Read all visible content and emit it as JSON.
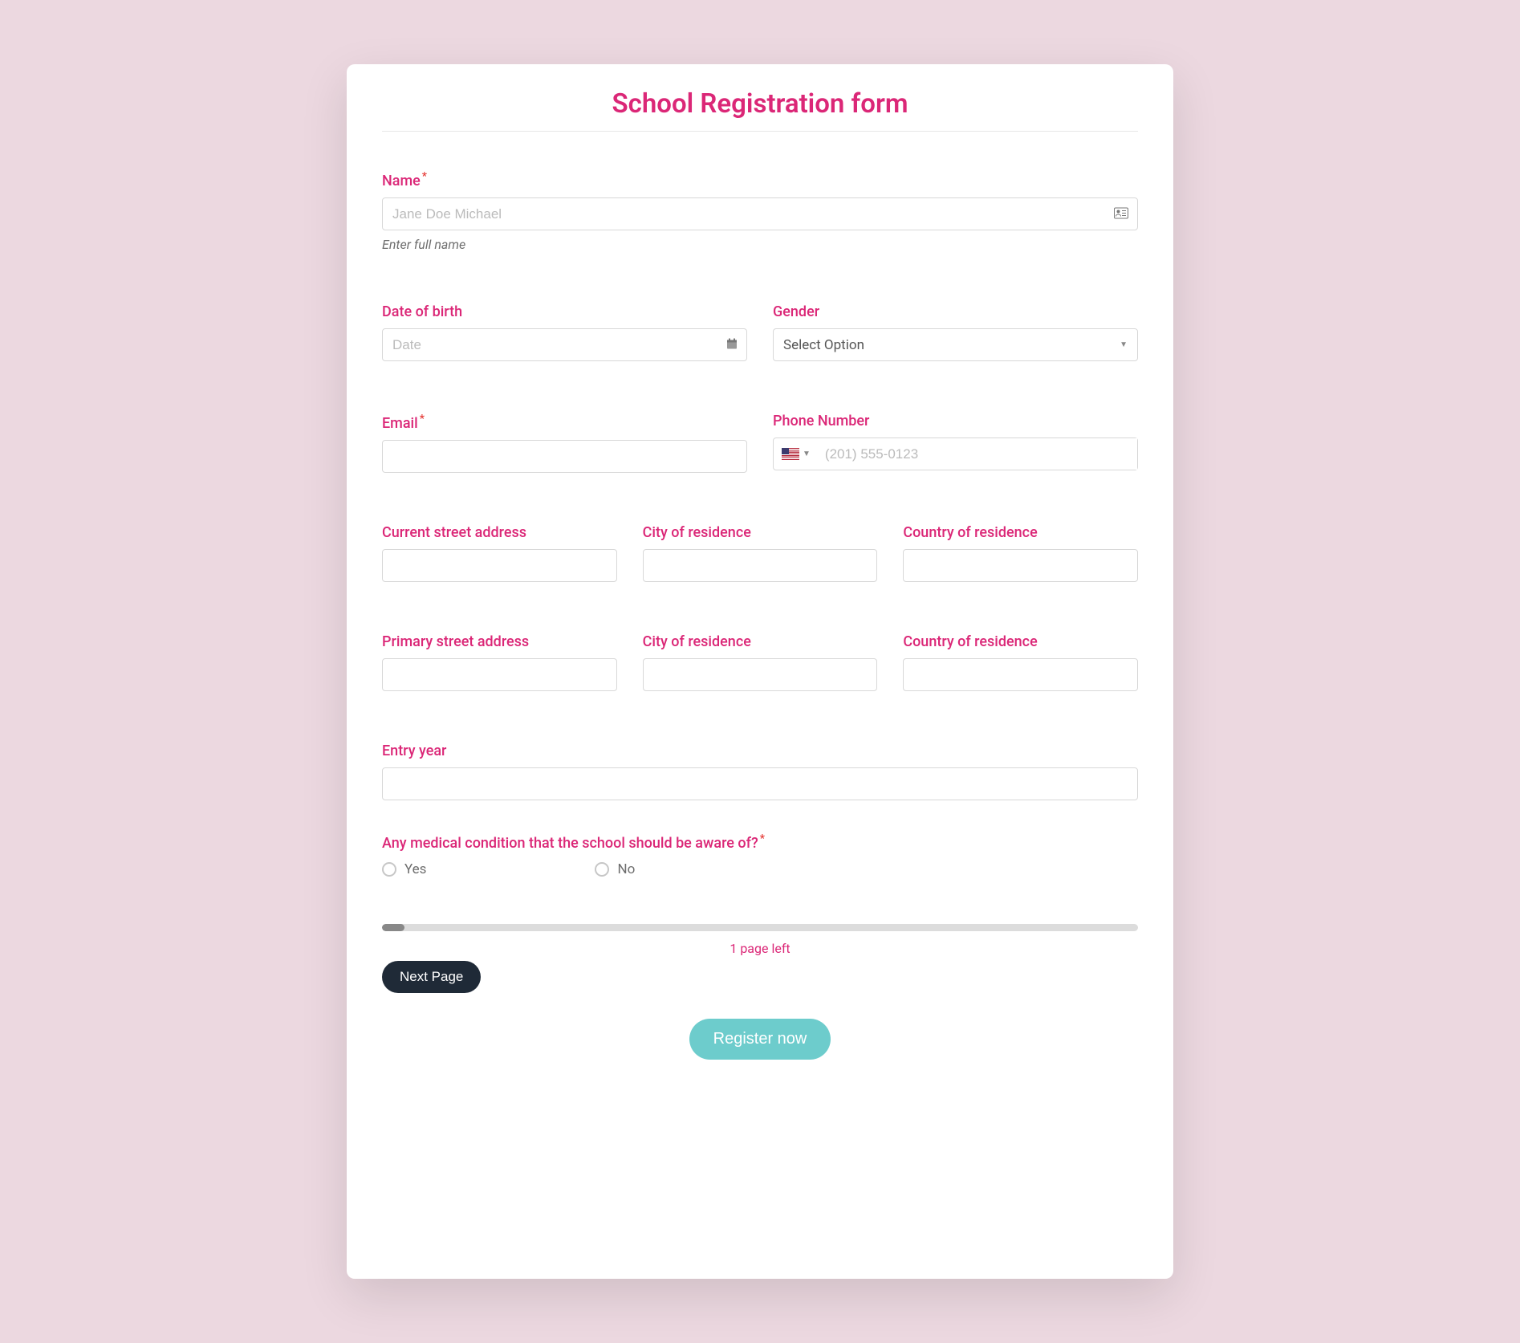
{
  "title": "School Registration form",
  "fields": {
    "name": {
      "label": "Name",
      "placeholder": "Jane Doe Michael",
      "helper": "Enter full name",
      "required": true
    },
    "dob": {
      "label": "Date of birth",
      "placeholder": "Date"
    },
    "gender": {
      "label": "Gender",
      "selected": "Select Option"
    },
    "email": {
      "label": "Email",
      "required": true
    },
    "phone": {
      "label": "Phone Number",
      "placeholder": "(201) 555-0123",
      "country": "US"
    },
    "current_street": {
      "label": "Current street address"
    },
    "current_city": {
      "label": "City of residence"
    },
    "current_country": {
      "label": "Country of residence"
    },
    "primary_street": {
      "label": "Primary street address"
    },
    "primary_city": {
      "label": "City of residence"
    },
    "primary_country": {
      "label": "Country of residence"
    },
    "entry_year": {
      "label": "Entry year"
    },
    "medical": {
      "label": "Any medical condition that the school should be aware of?",
      "required": true,
      "options": {
        "yes": "Yes",
        "no": "No"
      }
    }
  },
  "pagination": {
    "pages_left_text": "1 page left",
    "next_label": "Next Page"
  },
  "submit_label": "Register now"
}
